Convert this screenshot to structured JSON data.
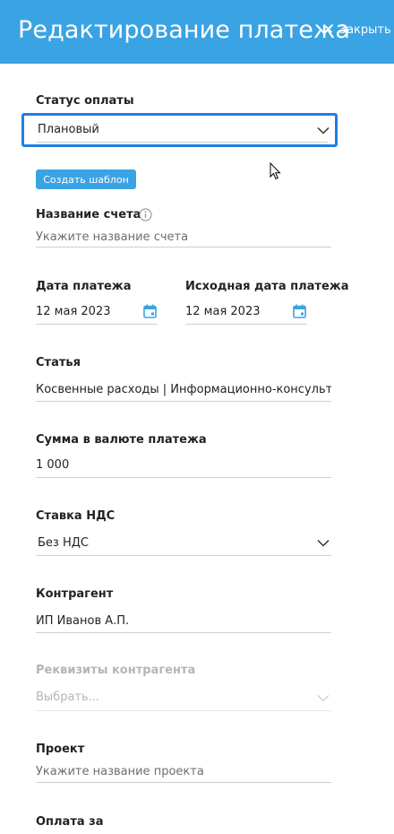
{
  "header": {
    "title": "Редактирование платежа",
    "close_icon": "×",
    "close_label": "Закрыть"
  },
  "colors": {
    "header_bg": "#3aa3e3",
    "focus_border": "#1f7fe3",
    "icon_blue": "#3aa3e3"
  },
  "form": {
    "payment_status": {
      "label": "Статус оплаты",
      "value": "Плановый"
    },
    "create_template_label": "Создать шаблон",
    "invoice_name": {
      "label": "Название счета",
      "placeholder": "Укажите название счета",
      "info_icon": "info-icon"
    },
    "payment_date": {
      "label": "Дата платежа",
      "value": "12 мая 2023"
    },
    "original_payment_date": {
      "label": "Исходная дата платежа",
      "value": "12 мая 2023"
    },
    "article": {
      "label": "Статья",
      "value": "Косвенные расходы | Информационно-консультационные"
    },
    "amount": {
      "label": "Сумма в валюте платежа",
      "value": "1 000"
    },
    "vat_rate": {
      "label": "Ставка НДС",
      "value": "Без НДС"
    },
    "counterparty": {
      "label": "Контрагент",
      "value": "ИП Иванов А.П."
    },
    "counterparty_details": {
      "label": "Реквизиты контрагента",
      "placeholder": "Выбрать..."
    },
    "project": {
      "label": "Проект",
      "placeholder": "Укажите название проекта"
    },
    "payment_for": {
      "label": "Оплата за"
    }
  }
}
